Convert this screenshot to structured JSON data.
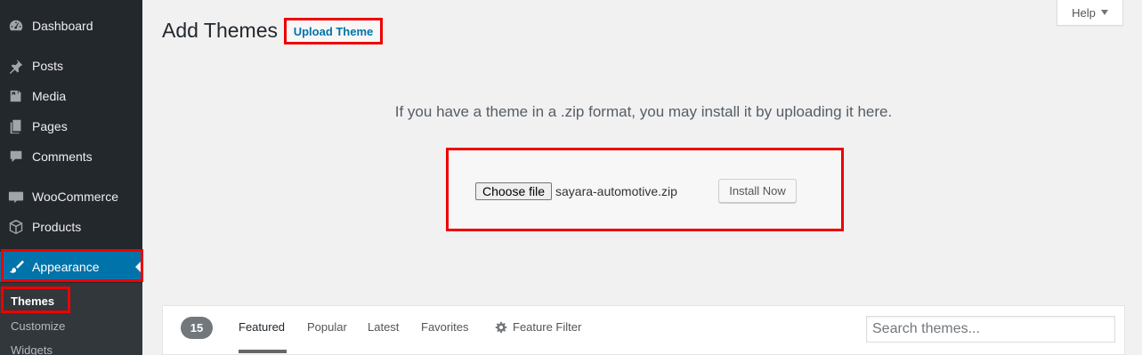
{
  "sidebar": {
    "items": [
      {
        "label": "Dashboard",
        "icon": "dashboard-icon"
      },
      {
        "label": "Posts",
        "icon": "pin-icon"
      },
      {
        "label": "Media",
        "icon": "media-icon"
      },
      {
        "label": "Pages",
        "icon": "pages-icon"
      },
      {
        "label": "Comments",
        "icon": "comment-icon"
      },
      {
        "label": "WooCommerce",
        "icon": "woocommerce-icon"
      },
      {
        "label": "Products",
        "icon": "box-icon"
      },
      {
        "label": "Appearance",
        "icon": "brush-icon"
      }
    ],
    "submenu": {
      "themes": "Themes",
      "customize": "Customize",
      "widgets": "Widgets"
    }
  },
  "header": {
    "title": "Add Themes",
    "upload_button": "Upload Theme",
    "help": "Help"
  },
  "upload": {
    "message": "If you have a theme in a .zip format, you may install it by uploading it here.",
    "choose_file": "Choose file",
    "file_name": "sayara-automotive.zip",
    "install_button": "Install Now"
  },
  "filter_bar": {
    "count": "15",
    "tabs": {
      "featured": "Featured",
      "popular": "Popular",
      "latest": "Latest",
      "favorites": "Favorites"
    },
    "feature_filter": "Feature Filter",
    "search_placeholder": "Search themes..."
  },
  "colors": {
    "sidebar_bg": "#23282d",
    "active_menu": "#0073aa",
    "highlight": "#ee0000",
    "link": "#0073aa"
  }
}
